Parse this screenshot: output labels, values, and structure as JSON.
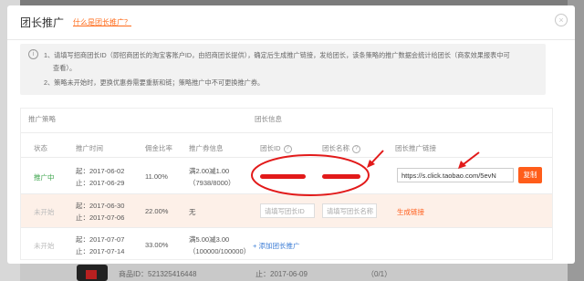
{
  "background": {
    "product_id_text": "商品ID：521325416448",
    "end_date_text": "止：2017-06-09",
    "count_text": "（0/1）"
  },
  "dialog": {
    "title": "团长推广",
    "help_link": "什么是团长推广？",
    "close_icon": "close-icon"
  },
  "notice": {
    "line1": "1、请填写招商团长ID（即招商团长的淘宝客账户ID，由招商团长提供），确定后生成推广链接，发给团长，该条策略的推广数据会统计给团长（商家效果报表中可",
    "line1_cont": "查看）。",
    "line2": "2、策略未开始时，更换优惠券需要重新和链；策略推广中不可更换推广券。"
  },
  "sections": {
    "strategy": "推广策略",
    "leader": "团长信息"
  },
  "columns": {
    "status": "状态",
    "time": "推广时间",
    "commission": "佣金比率",
    "coupon": "推广券信息",
    "leader_id": "团长ID",
    "leader_name": "团长名称",
    "link": "团长推广链接"
  },
  "rows": [
    {
      "status": "推广中",
      "start": "起：2017-06-02",
      "end": "止：2017-06-29",
      "commission": "11.00%",
      "coupon_line1": "满2.00减1.00",
      "coupon_line2": "（7938/8000）",
      "link_value": "https://s.click.taobao.com/5evN",
      "copy_label": "复制"
    },
    {
      "status": "未开始",
      "start": "起：2017-06-30",
      "end": "止：2017-07-06",
      "commission": "22.00%",
      "coupon_line1": "无",
      "leader_id_placeholder": "请填写团长ID",
      "leader_name_placeholder": "请填写团长名称",
      "action_label": "生成链接"
    },
    {
      "status": "未开始",
      "start": "起：2017-07-07",
      "end": "止：2017-07-14",
      "commission": "33.00%",
      "coupon_line1": "满5.00减3.00",
      "coupon_line2": "（100000/100000）",
      "action_label": "+ 添加团长推广"
    }
  ],
  "colors": {
    "accent": "#ff5d1a",
    "active": "#3aa34a",
    "link": "#3a7bd5",
    "annotation": "#e21a1a"
  }
}
